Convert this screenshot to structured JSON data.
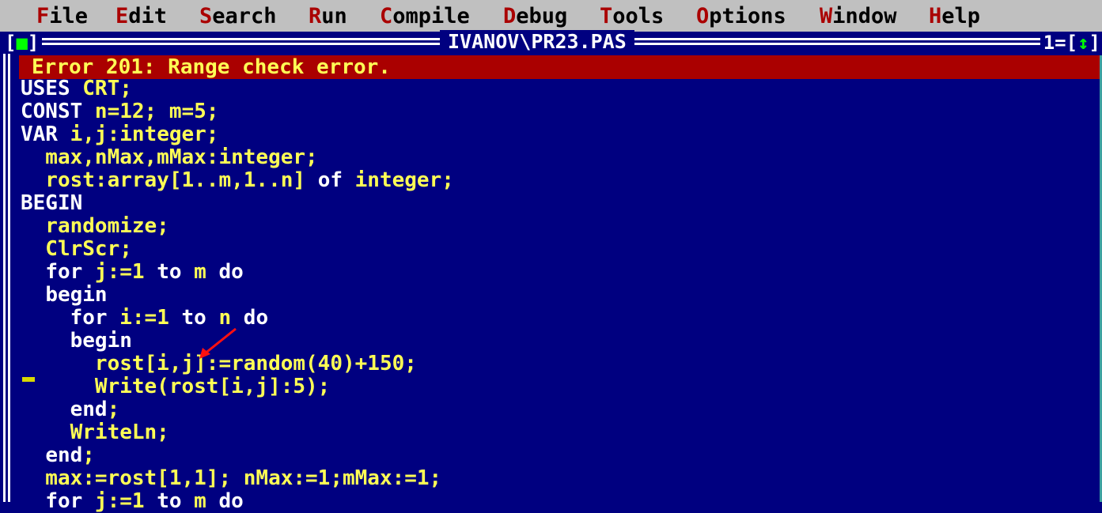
{
  "menu": {
    "items": [
      {
        "hotkey": "F",
        "rest": "ile"
      },
      {
        "hotkey": "E",
        "rest": "dit"
      },
      {
        "hotkey": "S",
        "rest": "earch"
      },
      {
        "hotkey": "R",
        "rest": "un"
      },
      {
        "hotkey": "C",
        "rest": "ompile"
      },
      {
        "hotkey": "D",
        "rest": "ebug"
      },
      {
        "hotkey": "T",
        "rest": "ools"
      },
      {
        "hotkey": "O",
        "rest": "ptions"
      },
      {
        "hotkey": "W",
        "rest": "indow"
      },
      {
        "hotkey": "H",
        "rest": "elp"
      }
    ]
  },
  "window": {
    "close_left": "[",
    "close_glyph": "■",
    "close_right": "]",
    "title": "IVANOV\\PR23.PAS",
    "number": "1=[",
    "zoom_glyph": "↕",
    "zoom_right": "]"
  },
  "error": {
    "message": "Error 201: Range check error."
  },
  "code": {
    "lines": [
      [
        {
          "t": "USES",
          "k": true
        },
        {
          "t": " CRT;"
        }
      ],
      [
        {
          "t": "CONST",
          "k": true
        },
        {
          "t": " n=12; m=5;"
        }
      ],
      [
        {
          "t": "VAR",
          "k": true
        },
        {
          "t": " i,j:integer;"
        }
      ],
      [
        {
          "t": "  max,nMax,mMax:integer;"
        }
      ],
      [
        {
          "t": "  rost:array[1..m,1..n] "
        },
        {
          "t": "of",
          "k": true
        },
        {
          "t": " integer;"
        }
      ],
      [
        {
          "t": "BEGIN",
          "k": true
        }
      ],
      [
        {
          "t": "  randomize;"
        }
      ],
      [
        {
          "t": "  ClrScr;"
        }
      ],
      [
        {
          "t": "  "
        },
        {
          "t": "for",
          "k": true
        },
        {
          "t": " j:=1 "
        },
        {
          "t": "to",
          "k": true
        },
        {
          "t": " m "
        },
        {
          "t": "do",
          "k": true
        }
      ],
      [
        {
          "t": "  "
        },
        {
          "t": "begin",
          "k": true
        }
      ],
      [
        {
          "t": "    "
        },
        {
          "t": "for",
          "k": true
        },
        {
          "t": " i:=1 "
        },
        {
          "t": "to",
          "k": true
        },
        {
          "t": " n "
        },
        {
          "t": "do",
          "k": true
        }
      ],
      [
        {
          "t": "    "
        },
        {
          "t": "begin",
          "k": true
        }
      ],
      [
        {
          "t": "      rost[i,j]:=random(40)+150;"
        }
      ],
      [
        {
          "t": "      Write(rost[i,j]:5);"
        }
      ],
      [
        {
          "t": "    "
        },
        {
          "t": "end",
          "k": true
        },
        {
          "t": ";"
        }
      ],
      [
        {
          "t": "    WriteLn;"
        }
      ],
      [
        {
          "t": "  "
        },
        {
          "t": "end",
          "k": true
        },
        {
          "t": ";"
        }
      ],
      [
        {
          "t": "  max:=rost[1,1]; nMax:=1;mMax:=1;"
        }
      ],
      [
        {
          "t": "  "
        },
        {
          "t": "for",
          "k": true
        },
        {
          "t": " j:=1 "
        },
        {
          "t": "to",
          "k": true
        },
        {
          "t": " m "
        },
        {
          "t": "do",
          "k": true
        }
      ]
    ]
  },
  "colors": {
    "background": "#000080",
    "menubar": "#c0c0c0",
    "hotkey": "#aa0000",
    "error_bar": "#aa0000",
    "code_text": "#ffff55",
    "keyword": "#ffffff",
    "annotation_arrow": "#ff0000"
  },
  "icons": {
    "close": "close-box-icon",
    "zoom": "zoom-arrows-icon",
    "arrow": "red-pointer-arrow-icon"
  }
}
